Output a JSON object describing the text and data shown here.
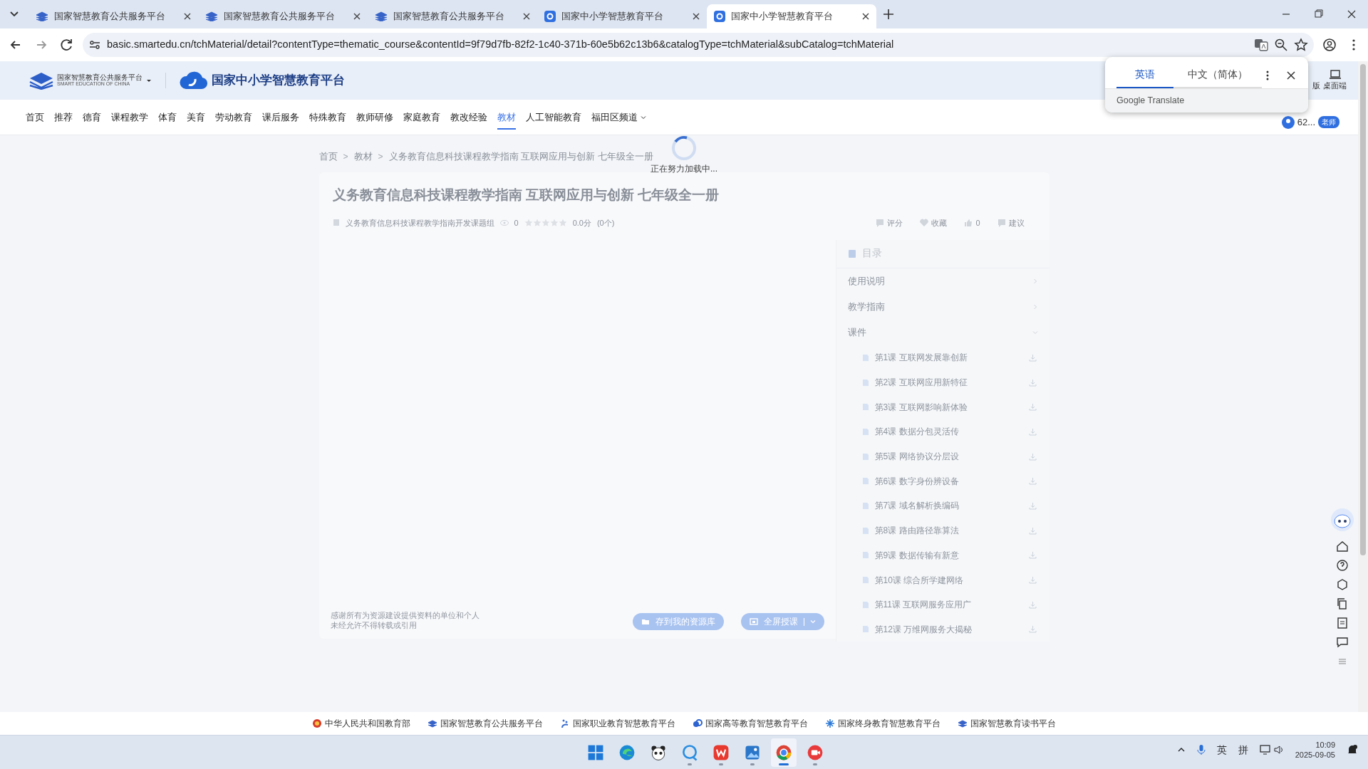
{
  "browser": {
    "tabs": [
      {
        "title": "国家智慧教育公共服务平台",
        "kind": "book",
        "selected": false
      },
      {
        "title": "国家智慧教育公共服务平台",
        "kind": "book",
        "selected": false
      },
      {
        "title": "国家智慧教育公共服务平台",
        "kind": "book",
        "selected": false
      },
      {
        "title": "国家中小学智慧教育平台",
        "kind": "ring",
        "selected": false
      },
      {
        "title": "国家中小学智慧教育平台",
        "kind": "ring",
        "selected": true
      }
    ],
    "url": "basic.smartedu.cn/tchMaterial/detail?contentType=thematic_course&contentId=9f79d7fb-82f2-1c40-371b-60e5b62c13b6&catalogType=tchMaterial&subCatalog=tchMaterial"
  },
  "translate_popup": {
    "languages": [
      {
        "label": "英语",
        "selected": true
      },
      {
        "label": "中文（简体）",
        "selected": false
      }
    ],
    "brand": "Google Translate"
  },
  "site_header": {
    "platform_logo": "国家智慧教育公共服务平台",
    "platform_logo_en": "SMART EDUCATION OF CHINA",
    "site_logo": "国家中小学智慧教育平台",
    "right_items": [
      "版",
      "桌面端"
    ]
  },
  "nav": {
    "items": [
      {
        "label": "首页",
        "selected": false
      },
      {
        "label": "推荐",
        "selected": false
      },
      {
        "label": "德育",
        "selected": false
      },
      {
        "label": "课程教学",
        "selected": false
      },
      {
        "label": "体育",
        "selected": false
      },
      {
        "label": "美育",
        "selected": false
      },
      {
        "label": "劳动教育",
        "selected": false
      },
      {
        "label": "课后服务",
        "selected": false
      },
      {
        "label": "特殊教育",
        "selected": false
      },
      {
        "label": "教师研修",
        "selected": false
      },
      {
        "label": "家庭教育",
        "selected": false
      },
      {
        "label": "教改经验",
        "selected": false
      },
      {
        "label": "教材",
        "selected": true
      },
      {
        "label": "人工智能教育",
        "selected": false
      },
      {
        "label": "福田区频道",
        "selected": false,
        "dropdown": true
      }
    ],
    "user_name": "62...",
    "user_badge": "老师"
  },
  "breadcrumb": [
    {
      "kind": "link",
      "text": "首页"
    },
    {
      "kind": "separator",
      "text": ">"
    },
    {
      "kind": "link",
      "text": "教材"
    },
    {
      "kind": "separator",
      "text": ">"
    },
    {
      "kind": "link",
      "text": "义务教育信息科技课程教学指南 互联网应用与创新 七年级全一册"
    }
  ],
  "loading_text": "正在努力加载中...",
  "resource": {
    "title": "义务教育信息科技课程教学指南 互联网应用与创新 七年级全一册",
    "author": "义务教育信息科技课程教学指南开发课题组",
    "views": "0",
    "stars": 0,
    "score": "0.0分",
    "rating_count": "(0个)",
    "actions": [
      {
        "kind": "rate",
        "label": "评分"
      },
      {
        "kind": "favorite",
        "label": "收藏"
      },
      {
        "kind": "like",
        "label": "0"
      },
      {
        "kind": "suggest",
        "label": "建议"
      }
    ],
    "notice": [
      "感谢所有为资源建设提供资料的单位和个人",
      "未经允许不得转载或引用"
    ],
    "buttons": [
      {
        "kind": "save",
        "label": "存到我的资源库"
      },
      {
        "kind": "fullscreen",
        "label": "全屏授课"
      }
    ]
  },
  "toc": {
    "title": "目录",
    "sections": [
      {
        "label": "使用说明",
        "expanded": false
      },
      {
        "label": "教学指南",
        "expanded": false
      },
      {
        "label": "课件",
        "expanded": true,
        "children": [
          {
            "label": "第1课 互联网发展靠创新"
          },
          {
            "label": "第2课 互联网应用新特征"
          },
          {
            "label": "第3课 互联网影响新体验"
          },
          {
            "label": "第4课 数据分包灵活传"
          },
          {
            "label": "第5课 网络协议分层设"
          },
          {
            "label": "第6课 数字身份辨设备"
          },
          {
            "label": "第7课 域名解析换编码"
          },
          {
            "label": "第8课 路由路径靠算法"
          },
          {
            "label": "第9课 数据传输有新意"
          },
          {
            "label": "第10课 综合所学建网络"
          },
          {
            "label": "第11课 互联网服务应用广"
          },
          {
            "label": "第12课 万维网服务大揭秘"
          }
        ]
      }
    ]
  },
  "footer_links": [
    {
      "kind": "emblem",
      "label": "中华人民共和国教育部"
    },
    {
      "kind": "book",
      "label": "国家智慧教育公共服务平台"
    },
    {
      "kind": "hand",
      "label": "国家职业教育智慧教育平台"
    },
    {
      "kind": "cloud",
      "label": "国家高等教育智慧教育平台"
    },
    {
      "kind": "snow",
      "label": "国家终身教育智慧教育平台"
    },
    {
      "kind": "book",
      "label": "国家智慧教育读书平台"
    }
  ],
  "taskbar": {
    "apps": [
      {
        "kind": "start",
        "running": false,
        "active": false
      },
      {
        "kind": "edge",
        "running": false,
        "active": false
      },
      {
        "kind": "panda",
        "running": false,
        "active": false
      },
      {
        "kind": "chat",
        "running": true,
        "active": false
      },
      {
        "kind": "wps",
        "running": true,
        "active": false
      },
      {
        "kind": "photos",
        "running": true,
        "active": false
      },
      {
        "kind": "chrome",
        "running": true,
        "active": true
      },
      {
        "kind": "record",
        "running": true,
        "active": false
      }
    ],
    "ime": [
      "英",
      "拼"
    ],
    "time": "10:09",
    "date": "2025-09-05"
  }
}
